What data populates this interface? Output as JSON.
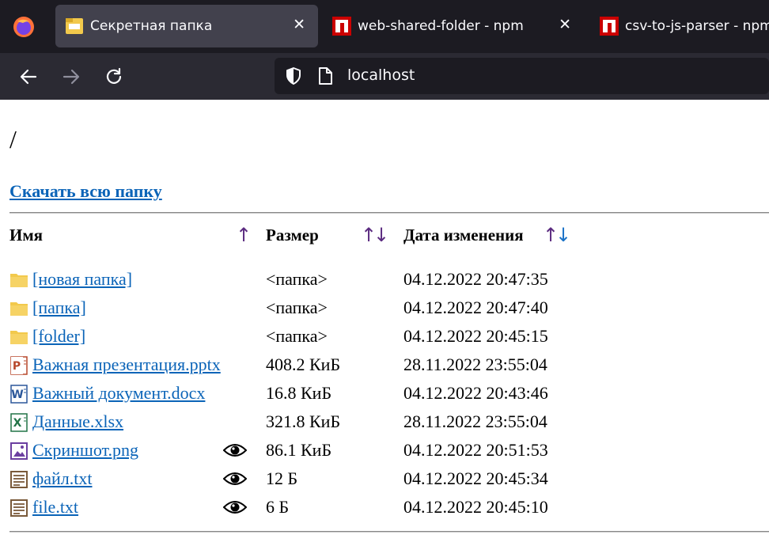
{
  "browser": {
    "tabs": [
      {
        "title": "Секретная папка",
        "active": true,
        "icon": "folder-icon"
      },
      {
        "title": "web-shared-folder - npm",
        "active": false,
        "icon": "npm-icon"
      },
      {
        "title": "csv-to-js-parser - npm",
        "active": false,
        "icon": "npm-icon"
      }
    ],
    "url": "localhost"
  },
  "page": {
    "path": "/",
    "download_link": "Скачать всю папку",
    "headers": {
      "name": "Имя",
      "size": "Размер",
      "date": "Дата изменения",
      "name_sort": "↑",
      "size_sort_up": "↑",
      "size_sort_down": "↓",
      "date_sort_up": "↑",
      "date_sort_down": "↓"
    },
    "files": [
      {
        "name": "[новая папка]",
        "type": "folder",
        "size": "<папка>",
        "date": "04.12.2022 20:47:35",
        "preview": false
      },
      {
        "name": "[папка]",
        "type": "folder",
        "size": "<папка>",
        "date": "04.12.2022 20:47:40",
        "preview": false
      },
      {
        "name": "[folder]",
        "type": "folder",
        "size": "<папка>",
        "date": "04.12.2022 20:45:15",
        "preview": false
      },
      {
        "name": "Важная презентация.pptx",
        "type": "pptx",
        "size": "408.2 КиБ",
        "date": "28.11.2022 23:55:04",
        "preview": false
      },
      {
        "name": "Важный документ.docx",
        "type": "docx",
        "size": "16.8 КиБ",
        "date": "04.12.2022 20:43:46",
        "preview": false
      },
      {
        "name": "Данные.xlsx",
        "type": "xlsx",
        "size": "321.8 КиБ",
        "date": "28.11.2022 23:55:04",
        "preview": false
      },
      {
        "name": "Скриншот.png",
        "type": "image",
        "size": "86.1 КиБ",
        "date": "04.12.2022 20:51:53",
        "preview": true
      },
      {
        "name": "файл.txt",
        "type": "text",
        "size": "12 Б",
        "date": "04.12.2022 20:45:34",
        "preview": true
      },
      {
        "name": "file.txt",
        "type": "text",
        "size": "6 Б",
        "date": "04.12.2022 20:45:10",
        "preview": true
      }
    ]
  },
  "colors": {
    "link": "#0b64b8",
    "sort_up": "#5b2b80",
    "sort_down": "#1a72c7",
    "folder": "#f2c94c"
  }
}
